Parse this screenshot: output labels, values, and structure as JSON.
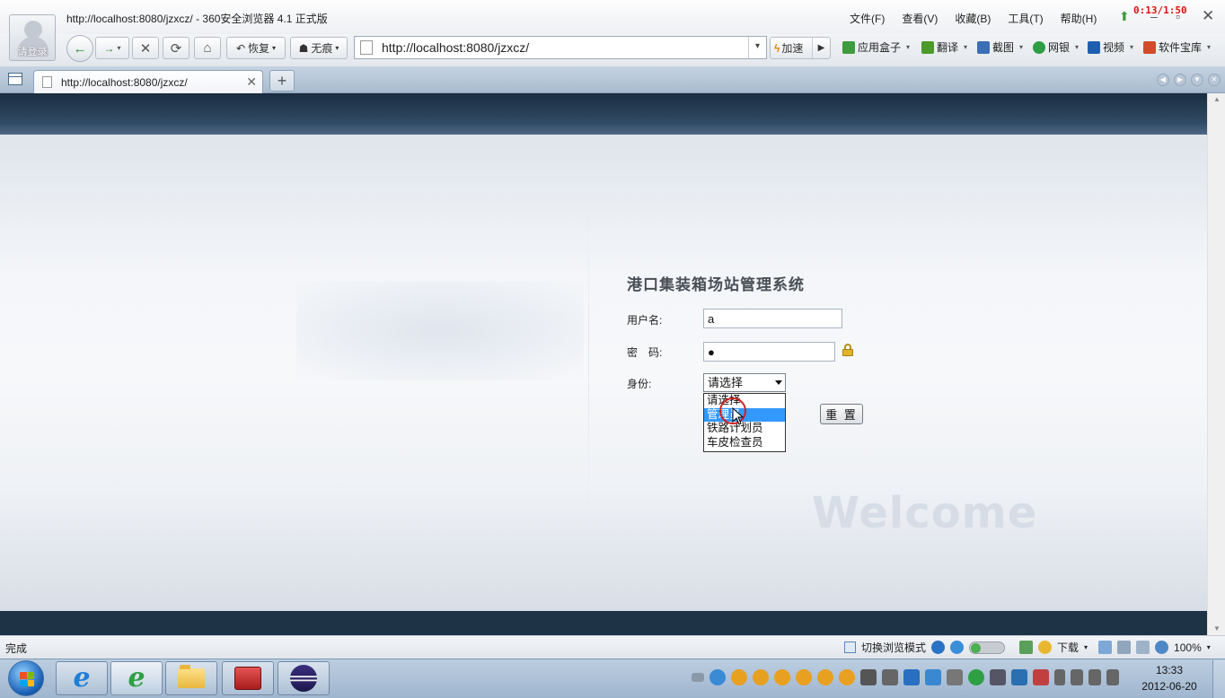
{
  "window": {
    "title": "http://localhost:8080/jzxcz/ - 360安全浏览器 4.1 正式版",
    "timer": "0:13/1:50",
    "avatar_label": "请登录"
  },
  "menu": [
    "文件(F)",
    "查看(V)",
    "收藏(B)",
    "工具(T)",
    "帮助(H)"
  ],
  "toolbar": {
    "restore_label": "恢复",
    "traceless_label": "无痕",
    "address": "http://localhost:8080/jzxcz/",
    "speed_label": "加速",
    "extensions": [
      {
        "label": "应用盒子",
        "color": "#3e9b3e"
      },
      {
        "label": "翻译",
        "color": "#4c9a2a"
      },
      {
        "label": "截图",
        "color": "#3a6fb5"
      },
      {
        "label": "网银",
        "color": "#2e9e44"
      },
      {
        "label": "视频",
        "color": "#1f5fb0"
      },
      {
        "label": "软件宝库",
        "color": "#d24a2a"
      }
    ]
  },
  "tabs": [
    {
      "label": "http://localhost:8080/jzxcz/"
    }
  ],
  "login": {
    "system_title": "港口集装箱场站管理系统",
    "username_label": "用户名:",
    "username_value": "a",
    "password_label": "密　码:",
    "password_value": "●",
    "role_label": "身份:",
    "role_selected": "请选择",
    "role_options": [
      "请选择",
      "管理员",
      "铁路计划员",
      "车皮检查员"
    ],
    "role_highlighted_index": 1,
    "reset_label": "重 置",
    "welcome_text": "Welcome"
  },
  "status": {
    "text": "完成",
    "mode_label": "切换浏览模式",
    "download_label": "下载",
    "zoom": "100%"
  },
  "taskbar": {
    "time": "13:33",
    "date": "2012-06-20"
  },
  "colors": {
    "page_header": "#1a2d40",
    "page_footer": "#1f3347",
    "selected_option": "#3399ff",
    "timer": "#e01010"
  }
}
